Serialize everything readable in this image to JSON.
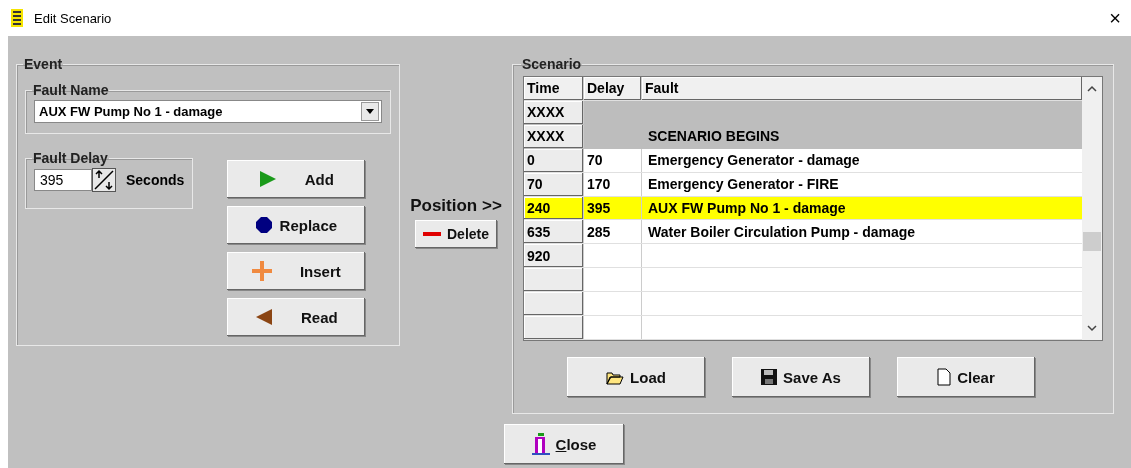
{
  "window": {
    "title": "Edit Scenario",
    "close": "×"
  },
  "event": {
    "title": "Event",
    "fault_name": {
      "title": "Fault Name",
      "value": "AUX FW Pump No 1 - damage"
    },
    "fault_delay": {
      "title": "Fault Delay",
      "value": "395",
      "unit": "Seconds"
    },
    "buttons": [
      {
        "label": "Add",
        "kind": "add"
      },
      {
        "label": "Replace",
        "kind": "replace"
      },
      {
        "label": "Insert",
        "kind": "insert"
      },
      {
        "label": "Read",
        "kind": "read"
      }
    ]
  },
  "position": {
    "label": "Position >>",
    "delete": "Delete"
  },
  "scenario": {
    "title": "Scenario",
    "table": {
      "columns": [
        "Time",
        "Delay",
        "Fault"
      ],
      "rows": [
        {
          "kind": "banner",
          "time": "XXXX",
          "selected": false
        },
        {
          "kind": "banner",
          "time": "XXXX",
          "fault": "SCENARIO BEGINS",
          "selected": false
        },
        {
          "kind": "entry",
          "time": "0",
          "delay": "70",
          "fault": "Emergency Generator - damage",
          "selected": false
        },
        {
          "kind": "entry",
          "time": "70",
          "delay": "170",
          "fault": "Emergency Generator - FIRE",
          "selected": false
        },
        {
          "kind": "entry",
          "time": "240",
          "delay": "395",
          "fault": "AUX FW Pump No 1 - damage",
          "selected": true
        },
        {
          "kind": "entry",
          "time": "635",
          "delay": "285",
          "fault": "Water Boiler Circulation Pump - damage",
          "selected": false
        },
        {
          "kind": "entry",
          "time": "920",
          "selected": false
        },
        {
          "kind": "entry",
          "selected": false
        },
        {
          "kind": "entry",
          "selected": false
        },
        {
          "kind": "entry",
          "selected": false
        }
      ]
    },
    "buttons": [
      {
        "label": "Load",
        "kind": "load"
      },
      {
        "label": "Save As",
        "kind": "save"
      },
      {
        "label": "Clear",
        "kind": "clear"
      }
    ]
  },
  "close_button": "Close"
}
